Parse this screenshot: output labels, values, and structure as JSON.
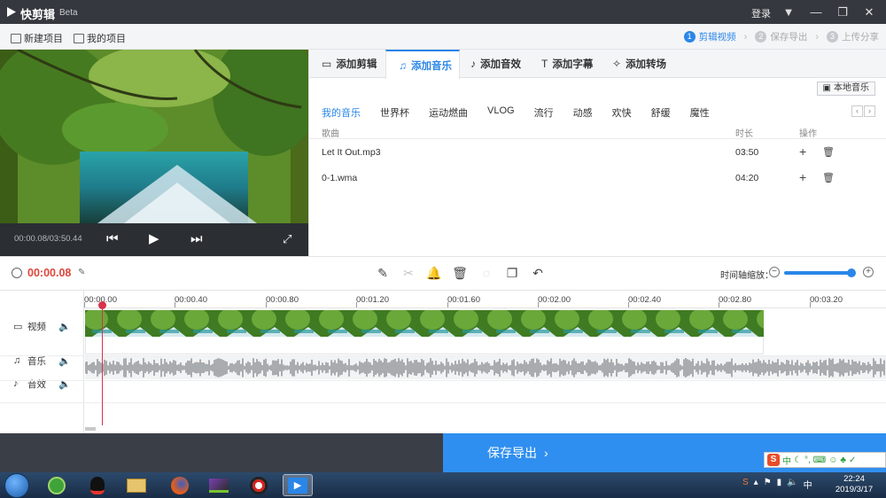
{
  "titlebar": {
    "app_name": "快剪辑",
    "beta": "Beta",
    "login": "登录"
  },
  "menubar": {
    "new_project": "新建项目",
    "my_projects": "我的项目",
    "steps": [
      {
        "num": "1",
        "label": "剪辑视频"
      },
      {
        "num": "2",
        "label": "保存导出"
      },
      {
        "num": "3",
        "label": "上传分享"
      }
    ]
  },
  "preview": {
    "time": "00:00.08/03:50.44"
  },
  "panel": {
    "tabs": [
      "添加剪辑",
      "添加音乐",
      "添加音效",
      "添加字幕",
      "添加转场"
    ],
    "local_music": "本地音乐",
    "categories": [
      "我的音乐",
      "世界杯",
      "运动燃曲",
      "VLOG",
      "流行",
      "动感",
      "欢快",
      "舒缓",
      "魔性"
    ],
    "columns": {
      "song": "歌曲",
      "duration": "时长",
      "action": "操作"
    },
    "songs": [
      {
        "name": "Let It Out.mp3",
        "duration": "03:50"
      },
      {
        "name": "0-1.wma",
        "duration": "04:20"
      }
    ]
  },
  "toolbar": {
    "current_time": "00:00.08",
    "zoom_label": "时间轴缩放：",
    "zoom_level": 1.0
  },
  "timeline": {
    "ticks": [
      "00:00.00",
      "00:00.40",
      "00:00.80",
      "00:01.20",
      "00:01.60",
      "00:02.00",
      "00:02.40",
      "00:02.80",
      "00:03.20"
    ],
    "tracks": {
      "video": "视频",
      "music": "音乐",
      "sfx": "音效"
    }
  },
  "export": {
    "label": "保存导出"
  },
  "taskbar": {
    "time": "22:24",
    "date": "2019/3/17"
  },
  "ime": {
    "label": "中"
  },
  "colors": {
    "accent": "#2a86e8",
    "time_red": "#e0443a",
    "export_blue": "#2f8ff0",
    "titlebar": "#35393f"
  }
}
